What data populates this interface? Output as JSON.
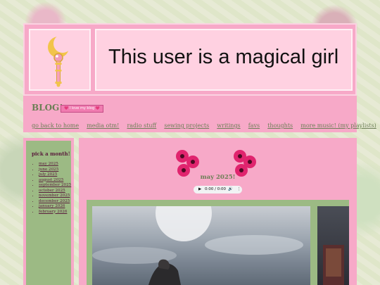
{
  "header": {
    "site_title": "This user is a magical girl",
    "wand_icon": "moon-wand-icon"
  },
  "nav": {
    "blog_title": "BLOG!",
    "badge_text": "💗 I love my blog 💗",
    "links": [
      "go back to home",
      "media otm!",
      "radio stuff",
      "sewing projects",
      "writings",
      "favs",
      "thoughts",
      "more music! (my playlists)"
    ]
  },
  "sidebar": {
    "heading": "pick a month!",
    "months": [
      "may 2025",
      "june 2025",
      "july 2025",
      "august 2025",
      "september 2025",
      "october 2025",
      "november 2025",
      "december 2025",
      "january 2026",
      "february 2026"
    ]
  },
  "main": {
    "month_title": "may 2025!",
    "audio": {
      "time": "0:00 / 0:00",
      "play_icon": "play-icon",
      "volume_icon": "volume-icon",
      "menu_icon": "more-vert-icon"
    },
    "flower_icon": "pink-gerbera-flower-icon"
  },
  "colors": {
    "pink_panel": "#f7a9c8",
    "light_pink": "#ffd1e1",
    "sage_green": "#9cba84",
    "link_green": "#6d7f57",
    "sidebar_text": "#5a1c3c"
  }
}
